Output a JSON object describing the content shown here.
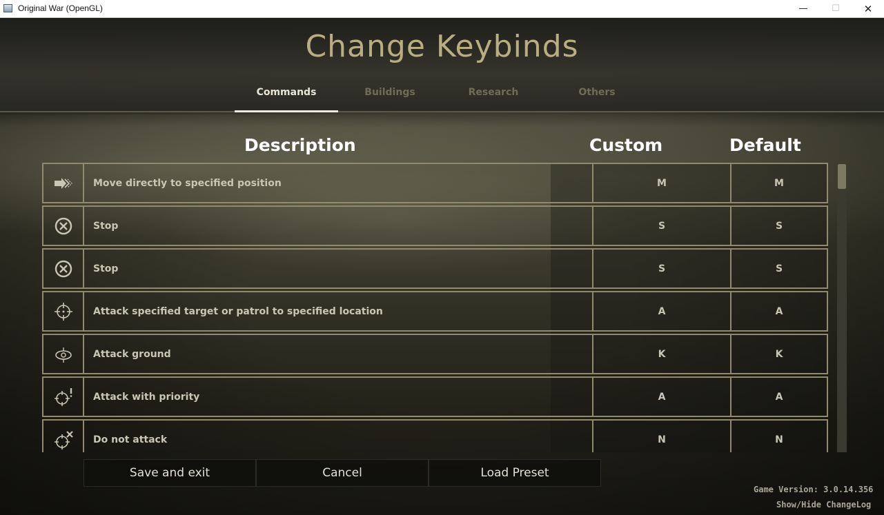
{
  "window": {
    "title": "Original War (OpenGL)",
    "minimize": "—",
    "maximize": "☐",
    "close": "✕"
  },
  "page": {
    "title": "Change Keybinds",
    "tabs": [
      {
        "label": "Commands",
        "active": true
      },
      {
        "label": "Buildings",
        "active": false
      },
      {
        "label": "Research",
        "active": false
      },
      {
        "label": "Others",
        "active": false
      }
    ]
  },
  "table": {
    "headers": {
      "description": "Description",
      "custom": "Custom",
      "default": "Default"
    },
    "rows": [
      {
        "icon": "move-direct-icon",
        "description": "Move directly to specified position",
        "custom": "M",
        "default": "M"
      },
      {
        "icon": "stop-icon",
        "description": "Stop",
        "custom": "S",
        "default": "S"
      },
      {
        "icon": "stop-icon",
        "description": "Stop",
        "custom": "S",
        "default": "S"
      },
      {
        "icon": "crosshair-icon",
        "description": "Attack specified target or patrol to specified location",
        "custom": "A",
        "default": "A"
      },
      {
        "icon": "attack-ground-icon",
        "description": "Attack ground",
        "custom": "K",
        "default": "K"
      },
      {
        "icon": "attack-priority-icon",
        "description": "Attack with priority",
        "custom": "A",
        "default": "A"
      },
      {
        "icon": "do-not-attack-icon",
        "description": "Do not attack",
        "custom": "N",
        "default": "N"
      }
    ]
  },
  "buttons": {
    "save": "Save and exit",
    "cancel": "Cancel",
    "load_preset": "Load Preset"
  },
  "footer": {
    "version": "Game Version: 3.0.14.356",
    "changelog": "Show/Hide ChangeLog"
  },
  "colors": {
    "title": "#b8ae82",
    "border": "#8f8b6c",
    "text": "#c9c6b4",
    "tab_inactive": "#6f6c57"
  }
}
